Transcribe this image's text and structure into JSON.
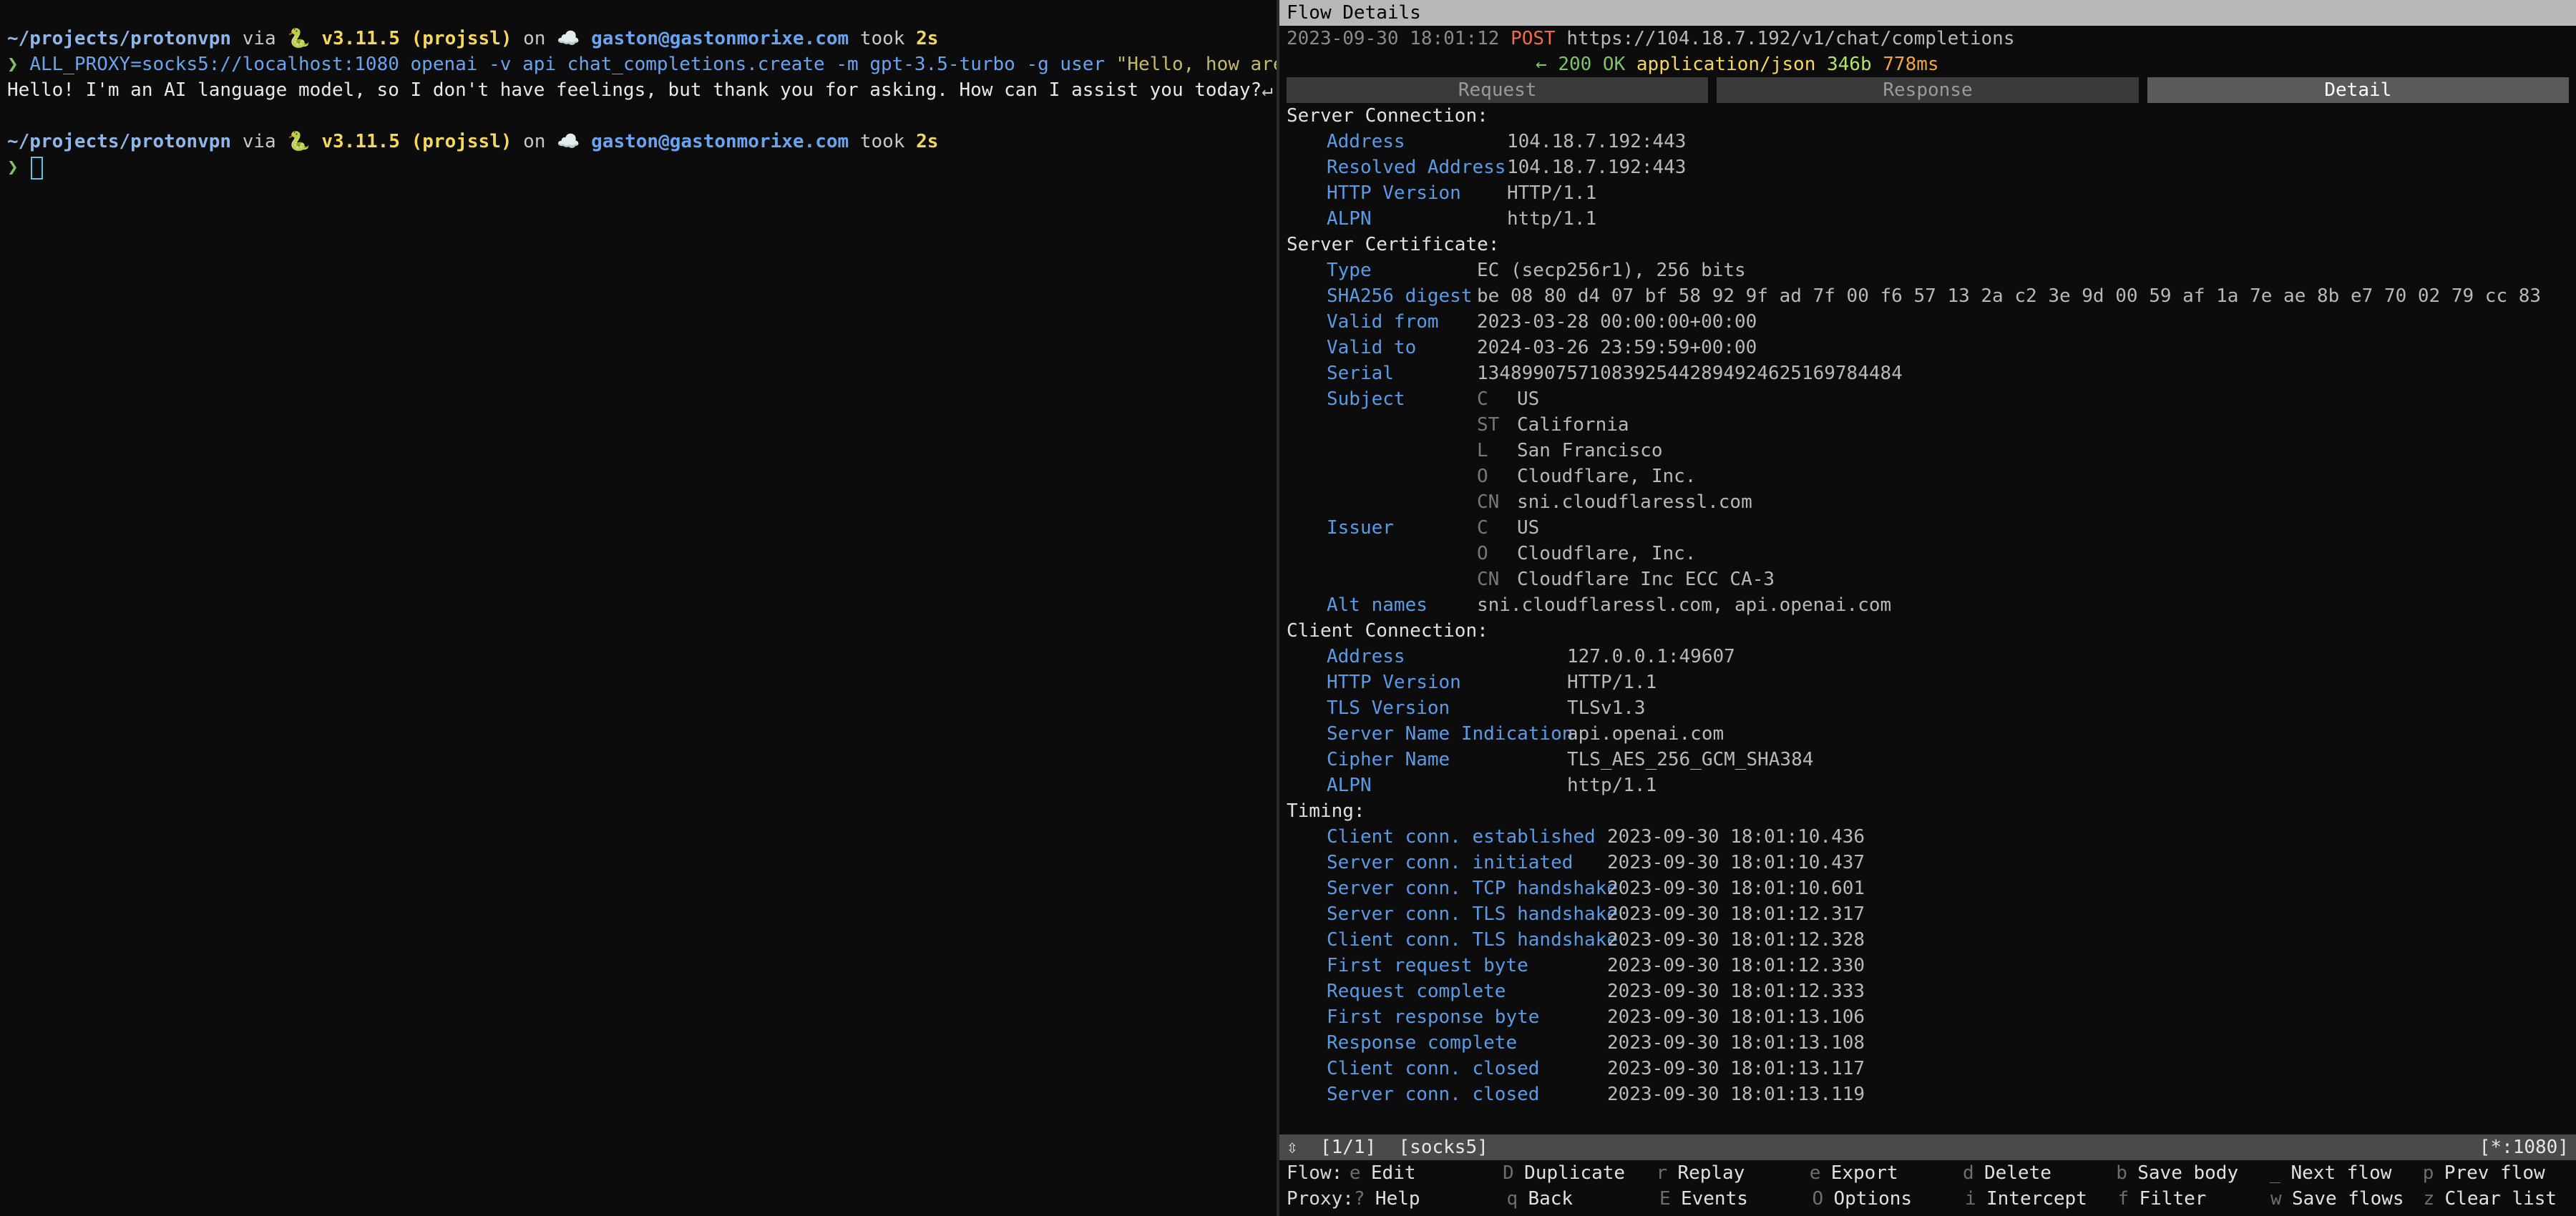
{
  "terminal": {
    "prompt1": {
      "path": "~/projects/protonvpn",
      "via": " via ",
      "python_icon": "python-icon",
      "python_ver": "v3.11.5 (projssl)",
      "on": " on ",
      "cloud_icon": "cloud-icon",
      "account": "gaston@gastonmorixe.com",
      "took": " took ",
      "duration": "2s"
    },
    "command": {
      "chevron": "❯",
      "env": "ALL_PROXY=socks5://localhost:1080",
      "bin": "openai",
      "args": "-v api chat_completions.create -m gpt-3.5-turbo -g user",
      "string": "\"Hello, how are you doing?\""
    },
    "output": "Hello! I'm an AI language model, so I don't have feelings, but thank you for asking. How can I assist you today?",
    "return_glyph": "↵",
    "prompt2": {
      "path": "~/projects/protonvpn",
      "via": " via ",
      "python_ver": "v3.11.5 (projssl)",
      "on": " on ",
      "account": "gaston@gastonmorixe.com",
      "took": " took ",
      "duration": "2s"
    },
    "prompt_chevron": "❯"
  },
  "flow": {
    "title": "Flow Details",
    "timestamp": "2023-09-30 18:01:12",
    "method": "POST",
    "url": "https://104.18.7.192/v1/chat/completions",
    "arrow": "←",
    "status": "200 OK",
    "content_type": "application/json",
    "size": "346b",
    "duration": "778ms",
    "tabs": [
      "Request",
      "Response",
      "Detail"
    ],
    "active_tab": "Detail",
    "server_connection": {
      "heading": "Server Connection:",
      "rows": [
        {
          "k": "Address",
          "v": "104.18.7.192:443"
        },
        {
          "k": "Resolved Address",
          "v": "104.18.7.192:443"
        },
        {
          "k": "HTTP Version",
          "v": "HTTP/1.1"
        },
        {
          "k": "ALPN",
          "v": "http/1.1"
        }
      ]
    },
    "server_certificate": {
      "heading": "Server Certificate:",
      "type_k": "Type",
      "type_v": "EC (secp256r1), 256 bits",
      "sha_k": "SHA256 digest",
      "sha_v": "be 08 80 d4 07 bf 58 92 9f ad 7f 00 f6 57 13 2a c2 3e 9d 00 59 af 1a 7e ae 8b e7 70 02 79 cc 83",
      "from_k": "Valid from",
      "from_v": "2023-03-28 00:00:00+00:00",
      "to_k": "Valid to",
      "to_v": "2024-03-26 23:59:59+00:00",
      "serial_k": "Serial",
      "serial_v": "13489907571083925442894924625169784484",
      "subject_k": "Subject",
      "subject": [
        {
          "k": "C",
          "v": "US"
        },
        {
          "k": "ST",
          "v": "California"
        },
        {
          "k": "L",
          "v": "San Francisco"
        },
        {
          "k": "O",
          "v": "Cloudflare, Inc."
        },
        {
          "k": "CN",
          "v": "sni.cloudflaressl.com"
        }
      ],
      "issuer_k": "Issuer",
      "issuer": [
        {
          "k": "C",
          "v": "US"
        },
        {
          "k": "O",
          "v": "Cloudflare, Inc."
        },
        {
          "k": "CN",
          "v": "Cloudflare Inc ECC CA-3"
        }
      ],
      "alt_k": "Alt names",
      "alt_v": "sni.cloudflaressl.com, api.openai.com"
    },
    "client_connection": {
      "heading": "Client Connection:",
      "rows": [
        {
          "k": "Address",
          "v": "127.0.0.1:49607"
        },
        {
          "k": "HTTP Version",
          "v": "HTTP/1.1"
        },
        {
          "k": "TLS Version",
          "v": "TLSv1.3"
        },
        {
          "k": "Server Name Indication",
          "v": "api.openai.com"
        },
        {
          "k": "Cipher Name",
          "v": "TLS_AES_256_GCM_SHA384"
        },
        {
          "k": "ALPN",
          "v": "http/1.1"
        }
      ]
    },
    "timing": {
      "heading": "Timing:",
      "rows": [
        {
          "k": "Client conn. established",
          "v": "2023-09-30 18:01:10.436"
        },
        {
          "k": "Server conn. initiated",
          "v": "2023-09-30 18:01:10.437"
        },
        {
          "k": "Server conn. TCP handshake",
          "v": "2023-09-30 18:01:10.601"
        },
        {
          "k": "Server conn. TLS handshake",
          "v": "2023-09-30 18:01:12.317"
        },
        {
          "k": "Client conn. TLS handshake",
          "v": "2023-09-30 18:01:12.328"
        },
        {
          "k": "First request byte",
          "v": "2023-09-30 18:01:12.330"
        },
        {
          "k": "Request complete",
          "v": "2023-09-30 18:01:12.333"
        },
        {
          "k": "First response byte",
          "v": "2023-09-30 18:01:13.106"
        },
        {
          "k": "Response complete",
          "v": "2023-09-30 18:01:13.108"
        },
        {
          "k": "Client conn. closed",
          "v": "2023-09-30 18:01:13.117"
        },
        {
          "k": "Server conn. closed",
          "v": "2023-09-30 18:01:13.119"
        }
      ]
    },
    "status_bar": {
      "left": "⇳  [1/1]  [socks5]",
      "right": "[*:1080]"
    },
    "help": {
      "flow_label": "Flow:",
      "flow_items": [
        {
          "k": "e",
          "t": "Edit"
        },
        {
          "k": "D",
          "t": "Duplicate"
        },
        {
          "k": "r",
          "t": "Replay"
        },
        {
          "k": "e",
          "t": "Export"
        },
        {
          "k": "d",
          "t": "Delete"
        },
        {
          "k": "b",
          "t": "Save body"
        },
        {
          "k": "_",
          "t": "Next flow"
        },
        {
          "k": "p",
          "t": "Prev flow"
        }
      ],
      "proxy_label": "Proxy:",
      "proxy_items": [
        {
          "k": "?",
          "t": "Help"
        },
        {
          "k": "q",
          "t": "Back"
        },
        {
          "k": "E",
          "t": "Events"
        },
        {
          "k": "O",
          "t": "Options"
        },
        {
          "k": "i",
          "t": "Intercept"
        },
        {
          "k": "f",
          "t": "Filter"
        },
        {
          "k": "w",
          "t": "Save flows"
        },
        {
          "k": "z",
          "t": "Clear list"
        }
      ]
    }
  }
}
